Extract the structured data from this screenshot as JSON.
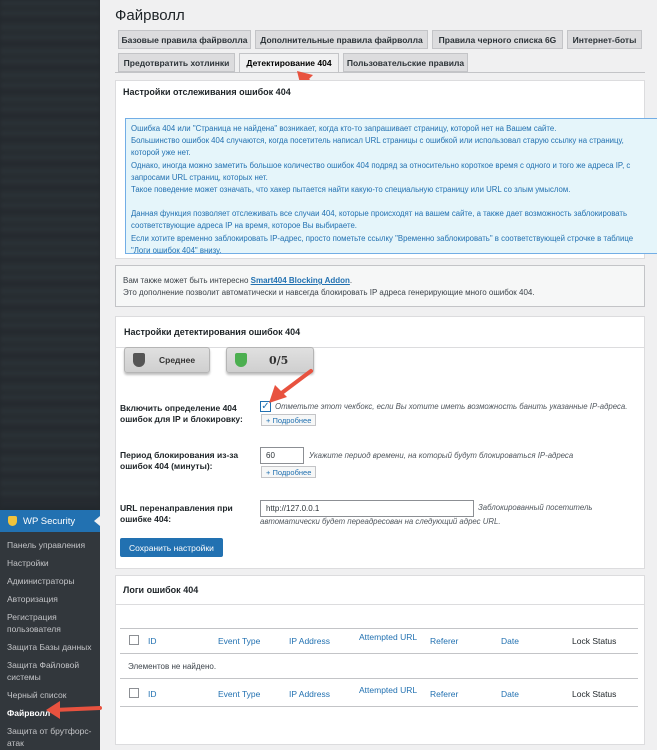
{
  "sidebar": {
    "section_title": "WP Security",
    "items": [
      {
        "label": "Панель управления"
      },
      {
        "label": "Настройки"
      },
      {
        "label": "Администраторы"
      },
      {
        "label": "Авторизация"
      },
      {
        "label": "Регистрация пользователя"
      },
      {
        "label": "Защита Базы данных"
      },
      {
        "label": "Защита Файловой системы"
      },
      {
        "label": "Черный список"
      },
      {
        "label": "Файрволл",
        "current": true
      },
      {
        "label": "Защита от брутфорс-атак"
      }
    ]
  },
  "page": {
    "title": "Файрволл"
  },
  "tabs": [
    {
      "label": "Базовые правила файрволла"
    },
    {
      "label": "Дополнительные правила файрволла"
    },
    {
      "label": "Правила черного списка 6G"
    },
    {
      "label": "Интернет-боты"
    },
    {
      "label": "Предотвратить хотлинки"
    },
    {
      "label": "Детектирование 404",
      "active": true
    },
    {
      "label": "Пользовательские правила"
    }
  ],
  "tracking_box": {
    "title": "Настройки отслеживания ошибок 404",
    "notice": [
      "Ошибка 404 или \"Страница не найдена\" возникает, когда кто-то запрашивает страницу, которой нет на Вашем сайте.",
      "Большинство ошибок 404 случаются, когда посетитель написал URL страницы с ошибкой или использовал старую ссылку на страницу,",
      "которой уже нет.",
      "Однако, иногда можно заметить большое количество ошибок 404 подряд за относительно короткое время с одного и того же адреса IP, с",
      "запросами URL страниц, которых нет.",
      "Такое поведение может означать, что хакер пытается найти какую-то специальную страницу или URL со злым умыслом.",
      "",
      "Данная функция позволяет отслеживать все случаи 404, которые происходят на вашем сайте, а также дает возможность заблокировать",
      "соответствующие адреса IP на время, которое Вы выбираете.",
      "Если хотите временно заблокировать IP-адрес, просто пометьте ссылку \"Временно заблокировать\" в соответствующей строчке в таблице",
      "\"Логи ошибок 404\" внизу."
    ]
  },
  "addon": {
    "prefix": "Вам также может быть интересно ",
    "link": "Smart404 Blocking Addon",
    "suffix": ".",
    "line2": "Это дополнение позволит автоматически и навсегда блокировать IP адреса генерирующие много ошибок 404."
  },
  "settings_box": {
    "title": "Настройки детектирования ошибок 404",
    "badge_level": "Среднее",
    "badge_score": "0/5",
    "enable_label": "Включить определение 404 ошибок для IP и блокировку:",
    "enable_checked": true,
    "enable_hint": "Отметьте этот чекбокс, если Вы хотите иметь возможность банить указанные IP-адреса.",
    "more_label": "+ Подробнее",
    "period_label": "Период блокирования из-за ошибок 404 (минуты):",
    "period_value": "60",
    "period_hint": "Укажите период времени, на который будут блокироваться IP-адреса",
    "redirect_label": "URL перенаправления при ошибке 404:",
    "redirect_value": "http://127.0.0.1",
    "redirect_hint_1": "Заблокированный посетитель",
    "redirect_hint_2": "автоматически будет переадресован на следующий адрес URL.",
    "save_label": "Сохранить настройки"
  },
  "logs_box": {
    "title": "Логи ошибок 404",
    "columns": [
      "ID",
      "Event Type",
      "IP Address",
      "Attempted URL",
      "Referer",
      "Date",
      "Lock Status"
    ],
    "empty_text": "Элементов не найдено."
  },
  "colors": {
    "accent": "#2271b1",
    "sidebar": "#23282d",
    "arrow": "#e8523f"
  }
}
